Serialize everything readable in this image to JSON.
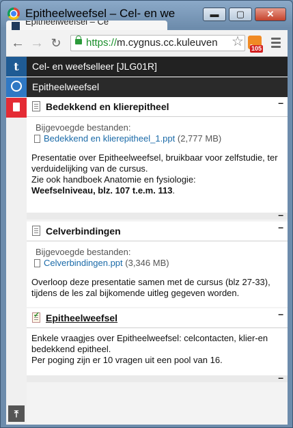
{
  "window": {
    "title": "Epitheelweefsel – Cel- en we",
    "tab_title": "Epitheelweefsel – Ce",
    "buttons": {
      "minimize": "▬",
      "maximize": "▢",
      "close": "✕"
    }
  },
  "toolbar": {
    "url_scheme": "https://",
    "url_rest": "m.cygnus.cc.kuleuven",
    "rss_badge": "105",
    "icons": [
      "back-icon",
      "forward-icon",
      "reload-icon",
      "lock-icon",
      "star-icon",
      "rss-icon",
      "menu-icon"
    ]
  },
  "leftbar": {
    "icons": [
      "t-icon",
      "compass-icon",
      "document-icon",
      "scroll-top-icon"
    ],
    "t_glyph": "t",
    "top_glyph": "⤒"
  },
  "header": {
    "course": "Cel- en weefselleer [JLG01R]",
    "page": "Epitheelweefsel"
  },
  "sections": [
    {
      "title": "Bedekkend en klierepitheel",
      "attachments_label": "Bijgevoegde bestanden:",
      "file_name": "Bedekkend en klierepitheel_1.ppt",
      "file_size": "(2,777 MB)",
      "desc_1": "Presentatie over Epitheelweefsel, bruikbaar voor zelfstudie, ter verduidelijking van de cursus.",
      "desc_2": "Zie ook handboek Anatomie en fysiologie:",
      "desc_bold": "Weefselniveau, blz. 107 t.e.m. 113",
      "desc_end": "."
    },
    {
      "title": "Celverbindingen",
      "attachments_label": "Bijgevoegde bestanden:",
      "file_name": "Celverbindingen.ppt",
      "file_size": "(3,346 MB)",
      "desc_1": "Overloop deze presentatie samen met de cursus (blz 27-33), tijdens de les zal bijkomende uitleg gegeven worden."
    },
    {
      "title": "Epitheelweefsel",
      "desc_1": "Enkele vraagjes over Epitheelweefsel: celcontacten, klier-en bedekkend epitheel.",
      "desc_2": "Per poging zijn er 10 vragen uit een pool van 16."
    }
  ],
  "collapse_glyph": "–"
}
